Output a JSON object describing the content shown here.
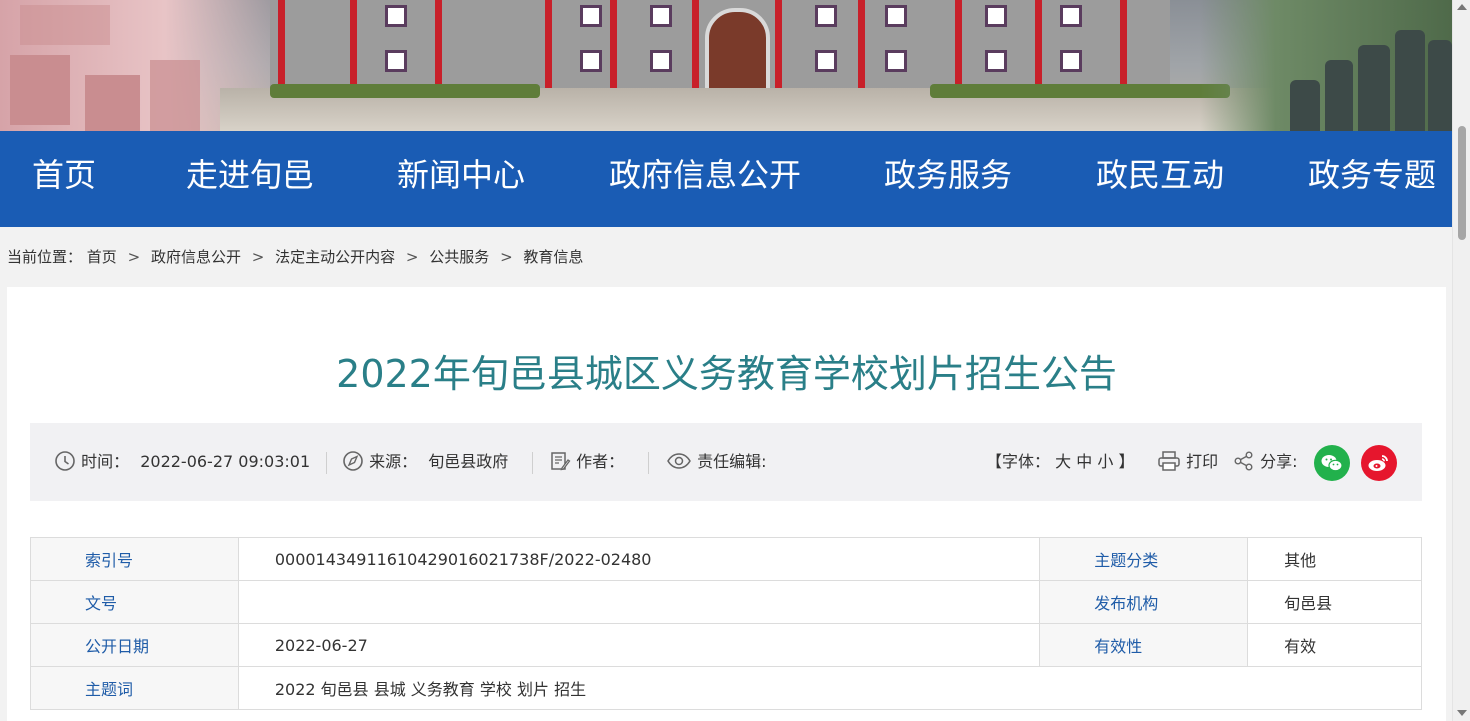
{
  "nav": {
    "items": [
      "首页",
      "走进旬邑",
      "新闻中心",
      "政府信息公开",
      "政务服务",
      "政民互动",
      "政务专题"
    ]
  },
  "breadcrumb": {
    "prefix": "当前位置：",
    "items": [
      "首页",
      "政府信息公开",
      "法定主动公开内容",
      "公共服务",
      "教育信息"
    ],
    "separator": ">"
  },
  "article": {
    "title": "2022年旬邑县城区义务教育学校划片招生公告"
  },
  "meta": {
    "time_label": "时间：",
    "time_value": "2022-06-27 09:03:01",
    "source_label": "来源：",
    "source_value": "旬邑县政府",
    "author_label": "作者：",
    "editor_label": "责任编辑:",
    "font_open": "【字体：",
    "font_large": "大",
    "font_medium": "中",
    "font_small": "小",
    "font_close": "】",
    "print_label": "打印",
    "share_label": "分享:"
  },
  "info_table": {
    "index_label": "索引号",
    "index_value": "000014349116104290160217‌38F/2022-02480",
    "category_label": "主题分类",
    "category_value": "其他",
    "docno_label": "文号",
    "docno_value": "",
    "publisher_label": "发布机构",
    "publisher_value": "旬邑县",
    "date_label": "公开日期",
    "date_value": "2022-06-27",
    "validity_label": "有效性",
    "validity_value": "有效",
    "keywords_label": "主题词",
    "keywords_value": "2022 旬邑县 县城 义务教育 学校 划片 招生"
  },
  "colors": {
    "nav_bg": "#1a5cb4",
    "title": "#2a7f88",
    "table_key": "#1f5ca8",
    "wechat": "#22b14c",
    "weibo": "#e6162d"
  },
  "icons": [
    "clock-icon",
    "compass-icon",
    "edit-icon",
    "eye-icon",
    "printer-icon",
    "share-icon",
    "wechat-icon",
    "weibo-icon"
  ]
}
